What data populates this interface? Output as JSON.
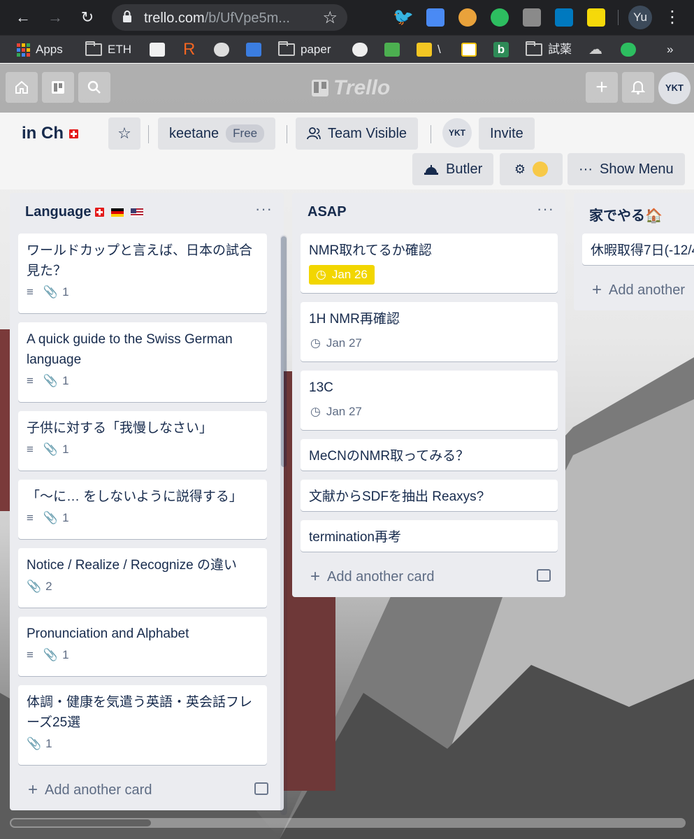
{
  "browser": {
    "url_domain": "trello.com",
    "url_path": "/b/UfVpe5m...",
    "profile_initials": "Yu",
    "bookmarks": {
      "apps": "Apps",
      "eth": "ETH",
      "r": "R",
      "paper": "paper",
      "backslash": "\\",
      "b": "b",
      "shiyaku": "試薬",
      "more": "»"
    }
  },
  "trello": {
    "logo_text": "Trello",
    "user_initials": "YKT"
  },
  "board": {
    "title": "in Ch",
    "team_name": "keetane",
    "plan_badge": "Free",
    "visibility": "Team Visible",
    "member_initials": "YKT",
    "invite_label": "Invite",
    "butler_label": "Butler",
    "show_menu_label": "Show Menu",
    "menu_dots": "···"
  },
  "lists": [
    {
      "title": "Language",
      "add_card_label": "Add another card",
      "cards": [
        {
          "title": "ワールドカップと言えば、日本の試合見た？",
          "attachments": "1"
        },
        {
          "title": "A quick guide to the Swiss German language",
          "attachments": "1"
        },
        {
          "title": "子供に対する「我慢しなさい」",
          "attachments": "1"
        },
        {
          "title": "「〜に… をしないように説得する」",
          "attachments": "1"
        },
        {
          "title": "Notice / Realize / Recognize の違い",
          "attachments": "2"
        },
        {
          "title": "Pronunciation and Alphabet",
          "attachments": "1"
        },
        {
          "title": "体調・健康を気遣う英語・英会話フレーズ25選",
          "attachments": "1"
        }
      ]
    },
    {
      "title": "ASAP",
      "add_card_label": "Add another card",
      "cards": [
        {
          "title": "NMR取れてるか確認",
          "due": "Jan 26"
        },
        {
          "title": "1H NMR再確認",
          "due": "Jan 27"
        },
        {
          "title": "13C",
          "due": "Jan 27"
        },
        {
          "title": "MeCNのNMR取ってみる？"
        },
        {
          "title": "文献からSDFを抽出 Reaxys?"
        },
        {
          "title": "termination再考"
        }
      ]
    },
    {
      "title": "家でやる🏠",
      "add_card_label": "Add another",
      "cards": [
        {
          "title": "休暇取得7日(-12/4"
        }
      ]
    }
  ],
  "colors": {
    "due_soon": "#f2d600",
    "list_bg": "#ebecf0",
    "text_primary": "#172b4d"
  }
}
